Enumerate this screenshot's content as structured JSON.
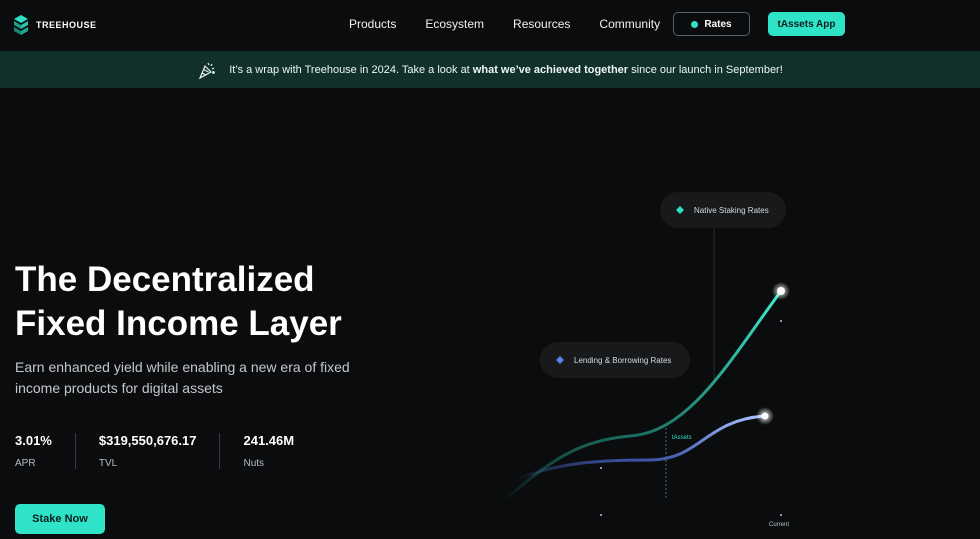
{
  "nav": {
    "logo_text": "TREEHOUSE",
    "links": [
      "Products",
      "Ecosystem",
      "Resources",
      "Community"
    ],
    "rates_label": "Rates",
    "app_label": "tAssets App"
  },
  "banner": {
    "prefix": "It’s a wrap with Treehouse in 2024. Take a look at ",
    "highlight": "what we’ve achieved together",
    "suffix": " since our launch in September!"
  },
  "hero": {
    "title_line1": "The Decentralized",
    "title_line2": "Fixed Income Layer",
    "subtitle": "Earn enhanced yield while enabling a new era of fixed income products for digital assets",
    "stats": [
      {
        "value": "3.01%",
        "label": "APR"
      },
      {
        "value": "$319,550,676.17",
        "label": "TVL"
      },
      {
        "value": "241.46M",
        "label": "Nuts"
      }
    ],
    "cta_label": "Stake Now"
  },
  "chart": {
    "native_label": "Native Staking Rates",
    "lending_label": "Lending & Borrowing Rates",
    "tassets_label": "tAssets",
    "current_label": "Current",
    "colors": {
      "native": "#2fe0c2",
      "lending": "#5b7cf0",
      "accent": "#2ee3c7"
    }
  }
}
